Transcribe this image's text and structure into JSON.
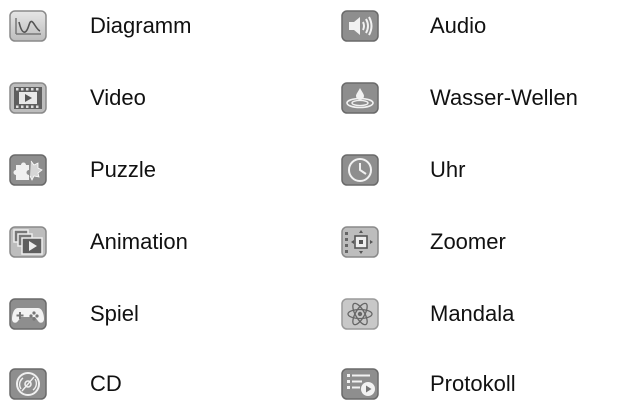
{
  "left_items": [
    {
      "label": "Diagramm",
      "icon": "line-chart-icon"
    },
    {
      "label": "Video",
      "icon": "video-film-icon"
    },
    {
      "label": "Puzzle",
      "icon": "puzzle-icon"
    },
    {
      "label": "Animation",
      "icon": "animation-frames-icon"
    },
    {
      "label": "Spiel",
      "icon": "gamepad-icon"
    },
    {
      "label": "CD",
      "icon": "cd-disc-icon"
    }
  ],
  "right_items": [
    {
      "label": "Audio",
      "icon": "speaker-icon"
    },
    {
      "label": "Wasser-Wellen",
      "icon": "water-drop-icon"
    },
    {
      "label": "Uhr",
      "icon": "clock-icon"
    },
    {
      "label": "Zoomer",
      "icon": "zoom-focus-icon"
    },
    {
      "label": "Mandala",
      "icon": "mandala-atom-icon"
    },
    {
      "label": "Protokoll",
      "icon": "log-list-icon"
    }
  ],
  "colors": {
    "icon_dark": "#6f6f6f",
    "icon_mid": "#9c9c9c",
    "icon_light": "#d8d8d8",
    "text": "#111111"
  }
}
